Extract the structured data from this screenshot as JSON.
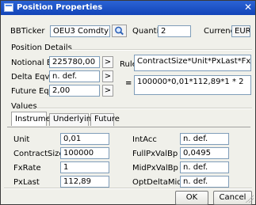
{
  "window": {
    "title": "Position Properties",
    "close_glyph": "✕",
    "icon": "app-window-icon"
  },
  "header": {
    "bbticker_label": "BBTicker",
    "bbticker_value": "OEU3 Comdty",
    "search_icon": "search-icon",
    "quantity_label": "Quantity",
    "quantity_value": "2",
    "currency_label": "Currency",
    "currency_value": "EUR"
  },
  "position_details": {
    "section_label": "Position Details",
    "notional_label": "Notional Eqv.",
    "notional_value": "225780,00",
    "delta_label": "Delta Eqv.",
    "delta_value": "n. def.",
    "future_label": "Future Eqv.",
    "future_value": "2,00",
    "arrow_glyph": ">",
    "rule_label": "Rule",
    "rule_formula": "ContractSize*Unit*PxLast*FxRate * Quantity",
    "equals": "=",
    "rule_result": "100000*0,01*112,89*1 * 2"
  },
  "values": {
    "section_label": "Values",
    "tabs": [
      {
        "label": "Instrument",
        "active": true
      },
      {
        "label": "Underlying",
        "active": false
      },
      {
        "label": "Future",
        "active": false
      }
    ],
    "left": [
      {
        "label": "Unit",
        "value": "0,01"
      },
      {
        "label": "ContractSize",
        "value": "100000"
      },
      {
        "label": "FxRate",
        "value": "1"
      },
      {
        "label": "PxLast",
        "value": "112,89"
      }
    ],
    "right": [
      {
        "label": "IntAcc",
        "value": "n. def."
      },
      {
        "label": "FullPxValBp",
        "value": "0,0495"
      },
      {
        "label": "MidPxValBp",
        "value": "n. def."
      },
      {
        "label": "OptDeltaMid",
        "value": "n. def."
      }
    ]
  },
  "footer": {
    "ok_label": "OK",
    "cancel_label": "Cancel"
  }
}
